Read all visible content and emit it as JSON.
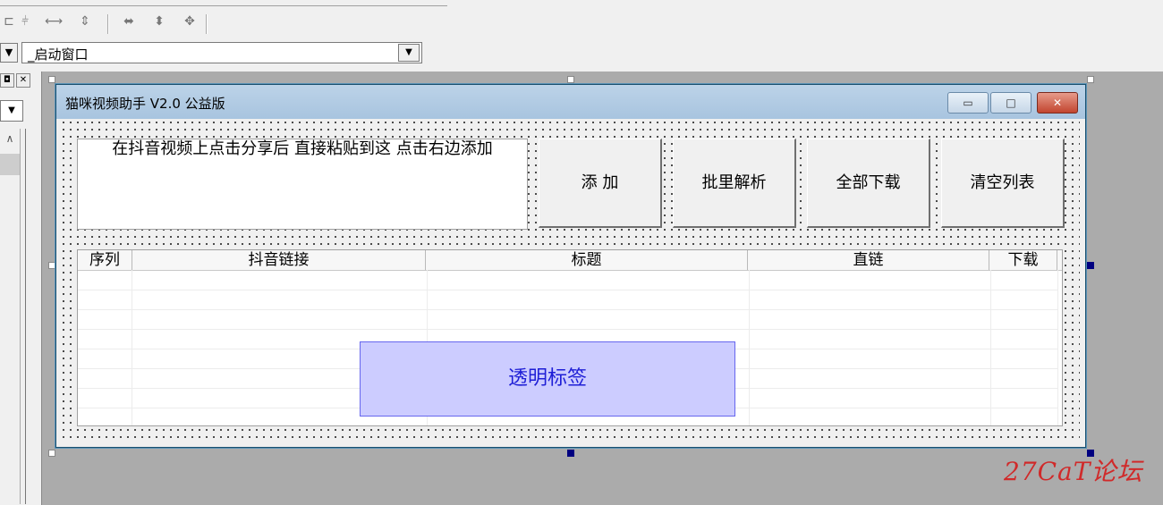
{
  "ide": {
    "object_combo": {
      "value": "_启动窗口"
    }
  },
  "form": {
    "title": "猫咪视频助手 V2.0 公益版",
    "window_buttons": {
      "minimize": "▭",
      "maximize": "□",
      "close": "✕"
    },
    "input": {
      "value": "在抖音视频上点击分享后 直接粘贴到这 点击右边添加"
    },
    "buttons": {
      "add": "添 加",
      "batch_parse": "批里解析",
      "download_all": "全部下载",
      "clear_list": "清空列表"
    },
    "list": {
      "columns": [
        "序列",
        "抖音链接",
        "标题",
        "直链",
        "下载"
      ]
    },
    "transparent_label": "透明标签"
  },
  "watermark": "27CaT论坛"
}
